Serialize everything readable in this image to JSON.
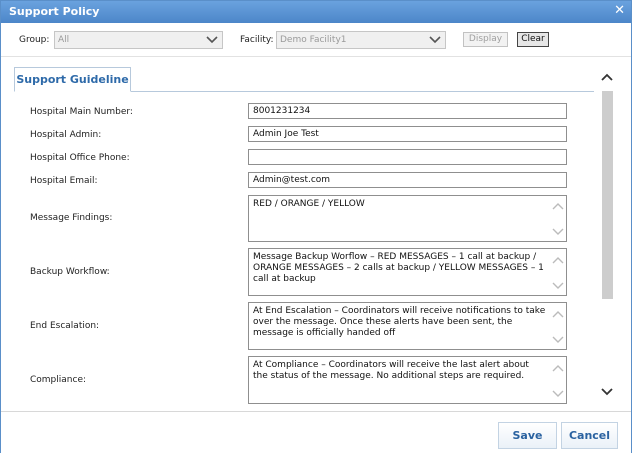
{
  "window": {
    "title": "Support Policy"
  },
  "filters": {
    "group_label": "Group:",
    "group_value": "All",
    "facility_label": "Facility:",
    "facility_value": "Demo Facility1",
    "display_label": "Display",
    "clear_label": "Clear"
  },
  "tab": {
    "label": "Support Guideline"
  },
  "form": {
    "hospital_main_number": {
      "label": "Hospital Main Number:",
      "value": "8001231234"
    },
    "hospital_admin": {
      "label": "Hospital Admin:",
      "value": "Admin Joe Test"
    },
    "hospital_office_phone": {
      "label": "Hospital Office Phone:",
      "value": ""
    },
    "hospital_email": {
      "label": "Hospital Email:",
      "value": "Admin@test.com"
    },
    "message_findings": {
      "label": "Message Findings:",
      "value": "RED / ORANGE / YELLOW"
    },
    "backup_workflow": {
      "label": "Backup Workflow:",
      "value": "Message Backup Worflow – RED MESSAGES – 1 call at backup / ORANGE MESSAGES – 2 calls at backup / YELLOW MESSAGES – 1 call at backup"
    },
    "end_escalation": {
      "label": "End Escalation:",
      "value": "At End Escalation – Coordinators will receive notifications to take over the message.  Once these alerts have been sent, the message is officially handed off"
    },
    "compliance": {
      "label": "Compliance:",
      "value": "At Compliance – Coordinators will receive the last alert about the status of the message.   No additional steps are required."
    }
  },
  "footer": {
    "save_label": "Save",
    "cancel_label": "Cancel"
  },
  "colors": {
    "titlebar": "#5b94d4",
    "accent": "#2e6aa9"
  }
}
